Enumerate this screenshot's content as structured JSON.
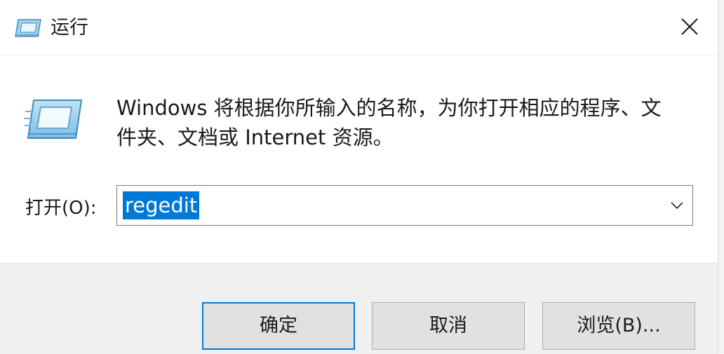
{
  "window": {
    "title": "运行",
    "title_icon": "run-dialog-icon",
    "close_icon": "close-icon"
  },
  "content": {
    "icon": "run-dialog-icon",
    "description_line1": "Windows 将根据你所输入的名称，为你打开相应的程序、文",
    "description_line2": "件夹、文档或 Internet 资源。"
  },
  "open_field": {
    "label": "打开(O):",
    "value": "regedit",
    "dropdown_icon": "chevron-down-icon"
  },
  "buttons": {
    "ok": "确定",
    "cancel": "取消",
    "browse": "浏览(B)..."
  },
  "colors": {
    "accent": "#0078d7",
    "footer_bg": "#f0f0f0",
    "button_bg": "#e1e1e1"
  }
}
